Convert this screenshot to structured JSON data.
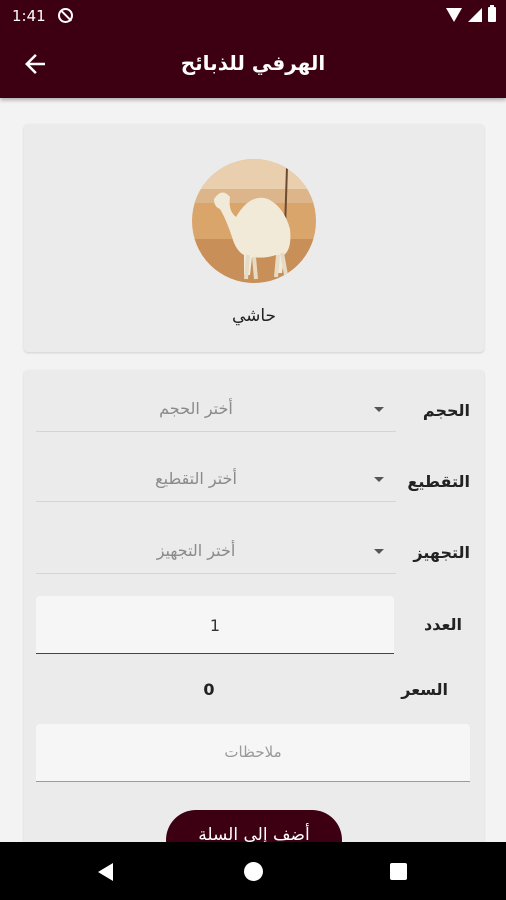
{
  "status_bar": {
    "time": "1:41",
    "icons": [
      "do-not-disturb-icon",
      "wifi-icon",
      "signal-icon",
      "battery-icon"
    ]
  },
  "app_bar": {
    "title": "الهرفي للذبائح",
    "back_icon": "arrow-back-icon"
  },
  "product": {
    "name": "حاشي",
    "image": "camel-photo"
  },
  "form": {
    "size": {
      "label": "الحجم",
      "placeholder": "أختر الحجم"
    },
    "cutting": {
      "label": "التقطيع",
      "placeholder": "أختر التقطيع"
    },
    "preparation": {
      "label": "التجهيز",
      "placeholder": "أختر التجهيز"
    },
    "quantity": {
      "label": "العدد",
      "value": "1"
    },
    "price": {
      "label": "السعر",
      "value": "0"
    },
    "notes": {
      "placeholder": "ملاحظات"
    },
    "add_button": "أضف إلى السلة"
  },
  "colors": {
    "primary": "#3d0012",
    "card": "#ebebeb",
    "background": "#f3f3f3"
  }
}
